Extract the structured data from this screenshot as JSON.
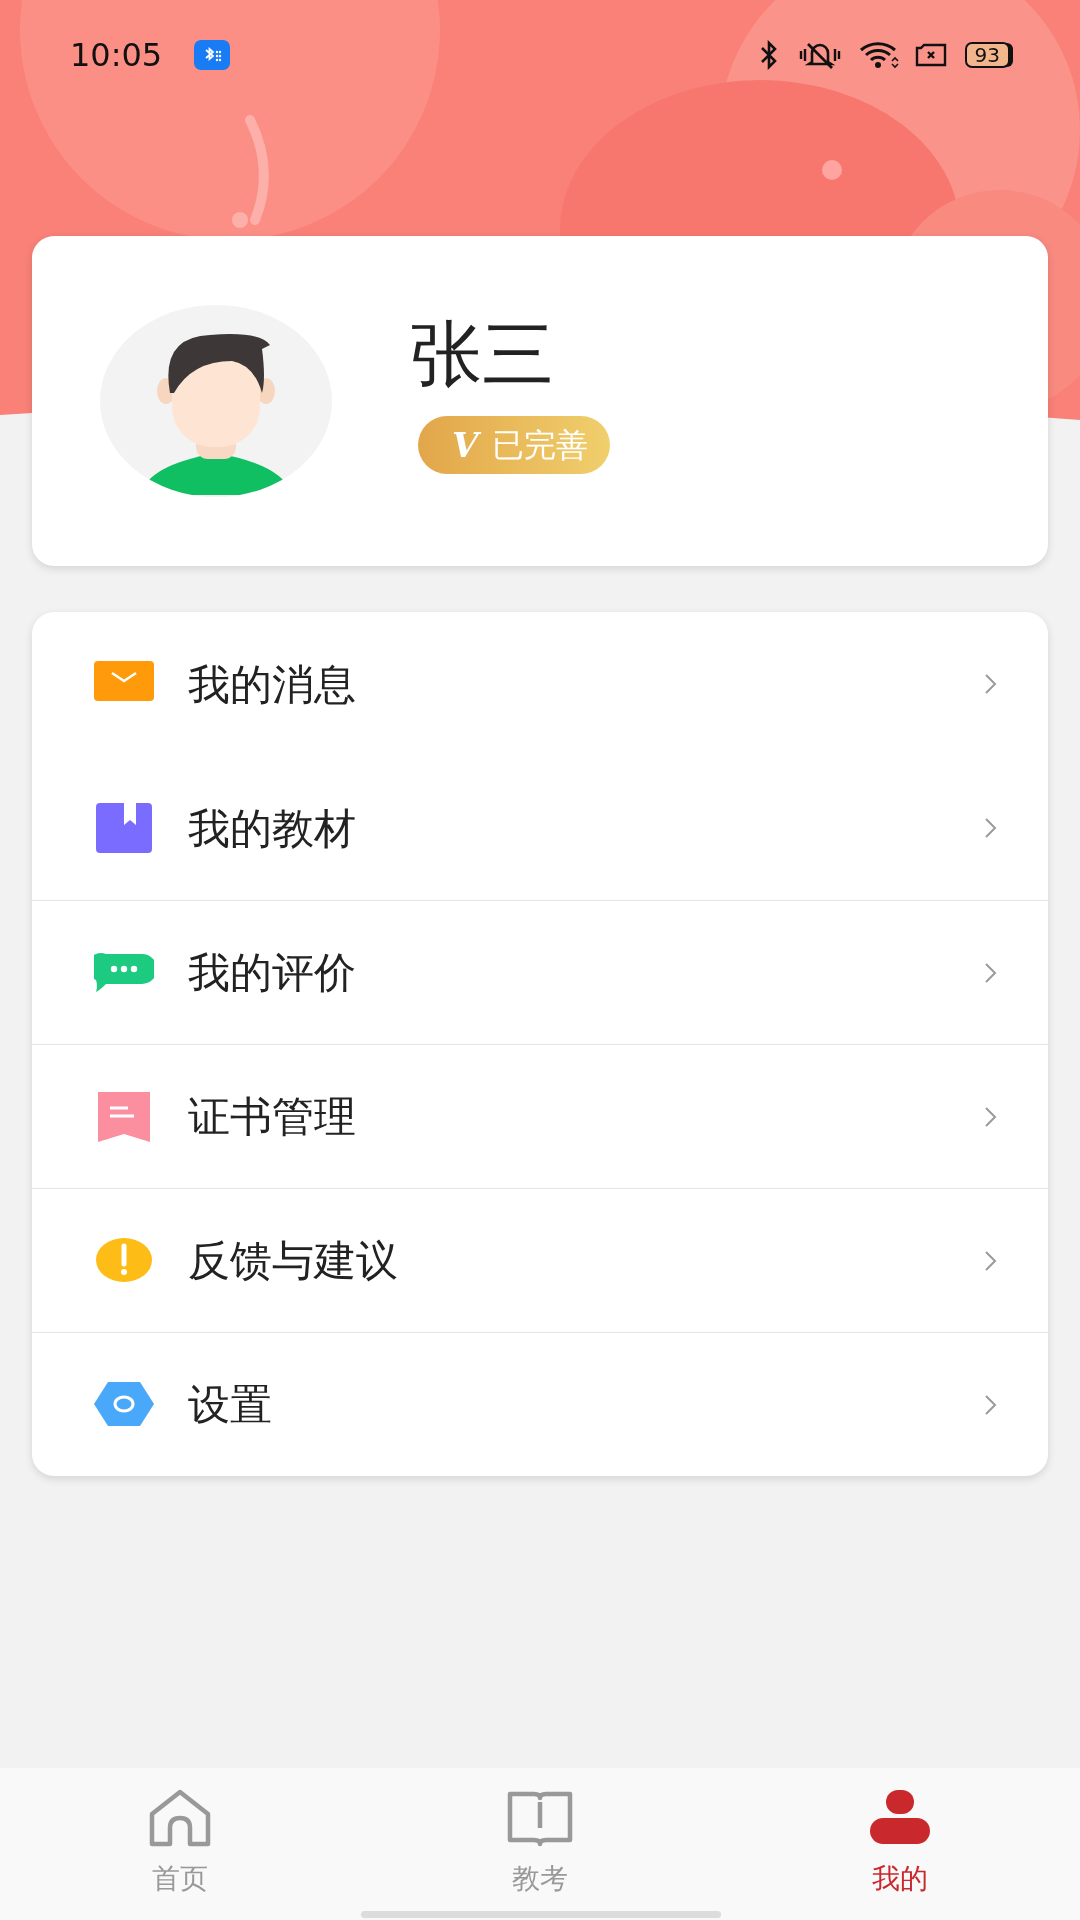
{
  "status_bar": {
    "time": "10:05",
    "battery": "93"
  },
  "profile": {
    "name": "张三",
    "badge_mark": "V",
    "badge_label": "已完善"
  },
  "menu": [
    {
      "label": "我的消息"
    },
    {
      "label": "我的教材"
    },
    {
      "label": "我的评价"
    },
    {
      "label": "证书管理"
    },
    {
      "label": "反馈与建议"
    },
    {
      "label": "设置"
    }
  ],
  "tab_bar": [
    {
      "label": "首页",
      "selected": false
    },
    {
      "label": "教考",
      "selected": false
    },
    {
      "label": "我的",
      "selected": true
    }
  ]
}
